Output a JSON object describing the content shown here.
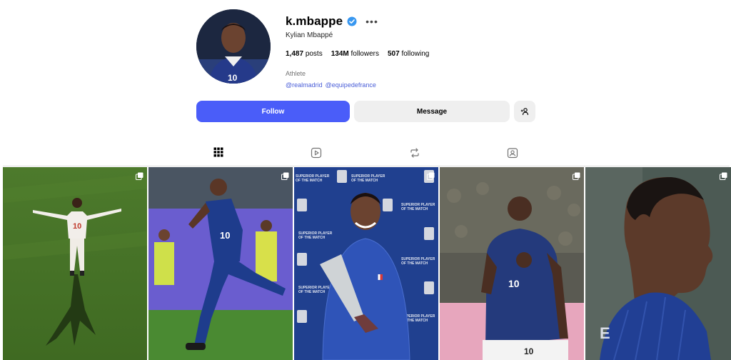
{
  "profile": {
    "username": "k.mbappe",
    "full_name": "Kylian Mbappé",
    "posts": "1,487",
    "posts_label": "posts",
    "followers": "134M",
    "followers_label": "followers",
    "following": "507",
    "following_label": "following",
    "category": "Athlete",
    "mentions": [
      "@realmadrid",
      "@equipedefrance"
    ]
  },
  "actions": {
    "follow_label": "Follow",
    "message_label": "Message"
  },
  "tabs": [
    {
      "name": "posts",
      "icon": "grid-icon"
    },
    {
      "name": "reels",
      "icon": "reels-icon"
    },
    {
      "name": "reposts",
      "icon": "repost-icon"
    },
    {
      "name": "tagged",
      "icon": "tagged-icon"
    }
  ],
  "posts": [
    {
      "icon": "carousel-icon"
    },
    {
      "icon": "carousel-icon"
    },
    {
      "icon": "carousel-icon"
    },
    {
      "icon": "carousel-icon"
    },
    {
      "icon": "carousel-icon"
    }
  ],
  "post_badges": {
    "banner_lines": [
      "SUPERIOR PLAYER",
      "OF THE MATCH"
    ]
  },
  "colors": {
    "accent": "#4a5df9",
    "verified": "#3897f0",
    "link": "#4a5ed8",
    "button_secondary": "#efefef"
  }
}
